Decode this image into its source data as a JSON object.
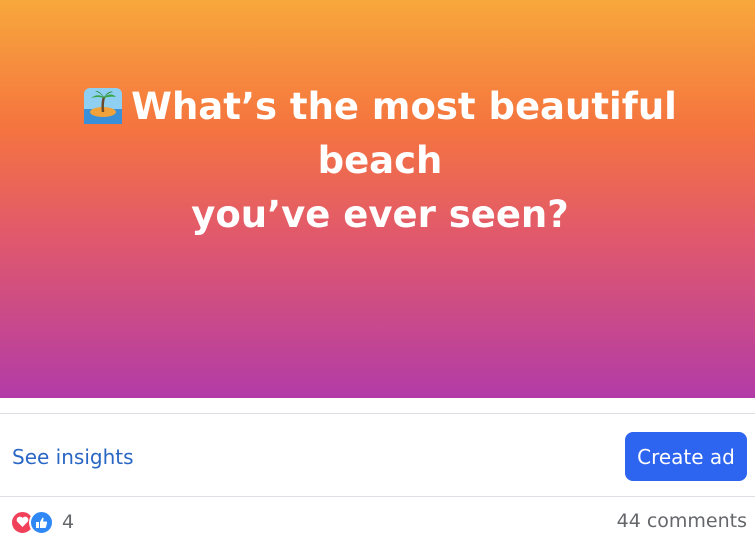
{
  "post": {
    "headline_line1": "What’s the most beautiful beach",
    "headline_line2": "you’ve ever seen?",
    "headline_emoji": "island-icon",
    "gradient_colors": [
      "#f7a83c",
      "#f5743f",
      "#e25a6a",
      "#b33ba7"
    ]
  },
  "actions": {
    "insights_label": "See insights",
    "create_ad_label": "Create ad",
    "accent": "#2d64f0"
  },
  "footer": {
    "reaction_icons": [
      "love-icon",
      "like-icon"
    ],
    "reaction_count": "4",
    "comments_label": "44 comments"
  }
}
